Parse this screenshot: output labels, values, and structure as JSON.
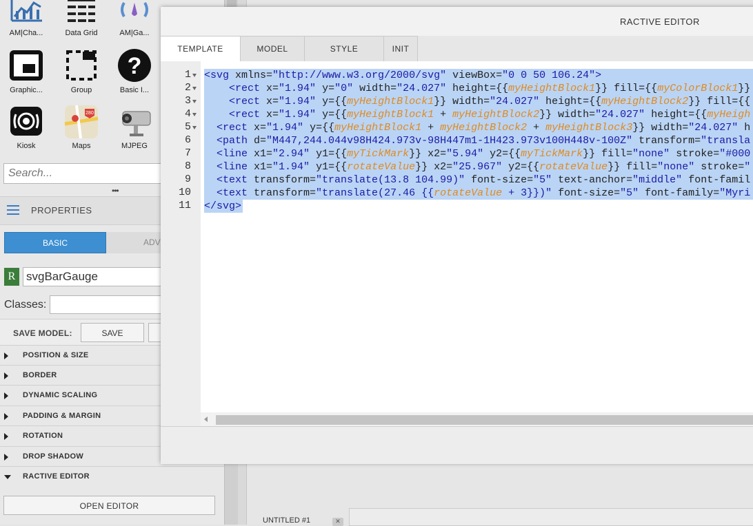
{
  "widgets": [
    {
      "label": "AM|Cha...",
      "icon": "line-chart-icon"
    },
    {
      "label": "Data Grid",
      "icon": "data-grid-icon"
    },
    {
      "label": "AM|Ga...",
      "icon": "gauge-icon"
    },
    {
      "label": "Graphic...",
      "icon": "graphic-frame-icon"
    },
    {
      "label": "Group",
      "icon": "group-icon"
    },
    {
      "label": "Basic I...",
      "icon": "help-icon"
    },
    {
      "label": "Kiosk",
      "icon": "kiosk-icon"
    },
    {
      "label": "Maps",
      "icon": "map-icon"
    },
    {
      "label": "MJPEG",
      "icon": "camera-icon"
    }
  ],
  "search": {
    "placeholder": "Search..."
  },
  "properties": {
    "title": "PROPERTIES",
    "tabs": {
      "basic": "BASIC",
      "advanced": "ADV"
    },
    "component_badge": "R",
    "name_value": "svgBarGauge",
    "classes_label": "Classes:",
    "classes_value": "",
    "save_model_label": "SAVE MODEL:",
    "save_button": "SAVE",
    "sections": [
      "POSITION & SIZE",
      "BORDER",
      "DYNAMIC SCALING",
      "PADDING & MARGIN",
      "ROTATION",
      "DROP SHADOW",
      "RACTIVE EDITOR"
    ],
    "open_editor_button": "OPEN EDITOR"
  },
  "canvas": {
    "tab_label": "UNTITLED #1",
    "tab_close": "✕"
  },
  "modal": {
    "title": "RACTIVE EDITOR",
    "tabs": [
      "TEMPLATE",
      "MODEL",
      "STYLE",
      "INIT"
    ],
    "active_tab": "TEMPLATE",
    "line_numbers": [
      "1",
      "2",
      "3",
      "4",
      "5",
      "6",
      "7",
      "8",
      "9",
      "10",
      "11"
    ]
  },
  "colors": {
    "accent": "#3d8fd1",
    "selection": "#bad4f5",
    "tag": "#1a1aa6",
    "variable": "#e08a1e"
  }
}
